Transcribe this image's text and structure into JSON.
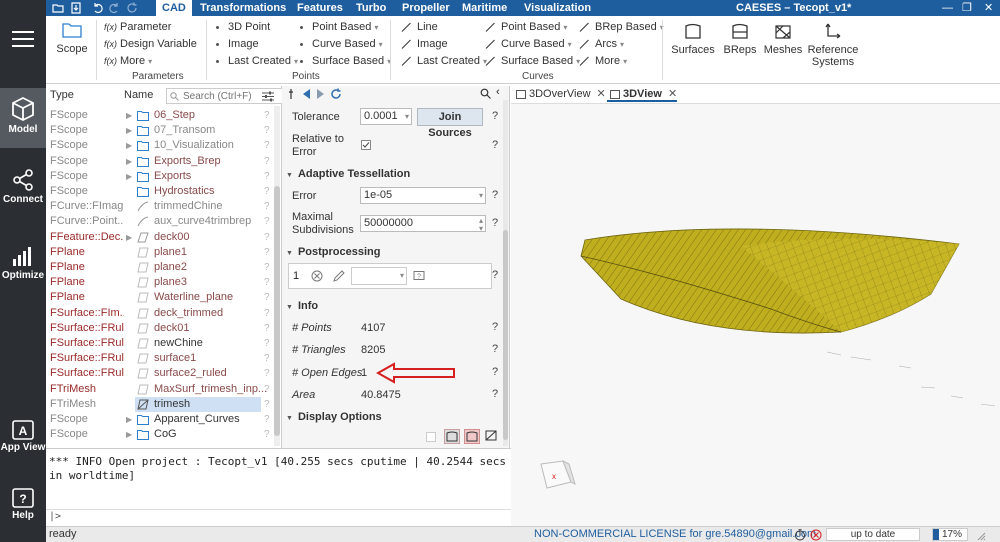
{
  "menubar": {
    "tabs": [
      "CAD",
      "Transformations",
      "Features",
      "Turbo",
      "Propeller",
      "Maritime",
      "Visualization"
    ],
    "active_tab": "CAD",
    "app_title": "CAESES  –  Tecopt_v1*"
  },
  "ribbon": {
    "scope_label": "Scope",
    "parameters": {
      "items": [
        "Parameter",
        "Design Variable",
        "More"
      ],
      "group_label": "Parameters"
    },
    "points": {
      "col1": [
        "3D Point",
        "Image",
        "Last Created"
      ],
      "col2": [
        "Point Based",
        "Curve Based",
        "Surface Based"
      ],
      "group_label": "Points"
    },
    "curves": {
      "col1": [
        "Line",
        "Image",
        "Last Created"
      ],
      "col2": [
        "Point Based",
        "Curve Based",
        "Surface Based"
      ],
      "col3": [
        "BRep Based",
        "Arcs",
        "More"
      ],
      "group_label": "Curves"
    },
    "big_buttons": [
      "Surfaces",
      "BReps",
      "Meshes",
      "Reference Systems"
    ]
  },
  "leftbar": {
    "items": [
      "Model",
      "Connect",
      "Optimize",
      "App View",
      "Help"
    ]
  },
  "tree": {
    "col_type": "Type",
    "col_name": "Name",
    "search_placeholder": "Search (Ctrl+F)",
    "rows": [
      {
        "type": "FScope",
        "name": "06_Step",
        "icon": "folder",
        "arrow": true,
        "type_red": false,
        "name_style": "red"
      },
      {
        "type": "FScope",
        "name": "07_Transom",
        "icon": "folder",
        "arrow": true,
        "type_red": false,
        "name_style": "grey"
      },
      {
        "type": "FScope",
        "name": "10_Visualization",
        "icon": "folder",
        "arrow": true,
        "type_red": false,
        "name_style": "grey"
      },
      {
        "type": "FScope",
        "name": "Exports_Brep",
        "icon": "folder",
        "arrow": true,
        "type_red": false,
        "name_style": "red"
      },
      {
        "type": "FScope",
        "name": "Exports",
        "icon": "folder",
        "arrow": true,
        "type_red": false,
        "name_style": "red"
      },
      {
        "type": "FScope",
        "name": "Hydrostatics",
        "icon": "folder",
        "arrow": false,
        "type_red": false,
        "name_style": "red"
      },
      {
        "type": "FCurve::FImag...",
        "name": "trimmedChine",
        "icon": "curve",
        "arrow": false,
        "type_red": false,
        "name_style": "grey"
      },
      {
        "type": "FCurve::Point...",
        "name": "aux_curve4trimbrep",
        "icon": "curve",
        "arrow": false,
        "type_red": false,
        "name_style": "grey"
      },
      {
        "type": "FFeature::Dec...",
        "name": "deck00",
        "icon": "feature",
        "arrow": true,
        "type_red": true,
        "name_style": "red"
      },
      {
        "type": "FPlane",
        "name": "plane1",
        "icon": "plane",
        "arrow": false,
        "type_red": true,
        "name_style": "red"
      },
      {
        "type": "FPlane",
        "name": "plane2",
        "icon": "plane",
        "arrow": false,
        "type_red": true,
        "name_style": "red"
      },
      {
        "type": "FPlane",
        "name": "plane3",
        "icon": "plane",
        "arrow": false,
        "type_red": true,
        "name_style": "red"
      },
      {
        "type": "FPlane",
        "name": "Waterline_plane",
        "icon": "plane",
        "arrow": false,
        "type_red": true,
        "name_style": "red"
      },
      {
        "type": "FSurface::FIm...",
        "name": "deck_trimmed",
        "icon": "plane",
        "arrow": false,
        "type_red": true,
        "name_style": "red"
      },
      {
        "type": "FSurface::FRul...",
        "name": "deck01",
        "icon": "plane",
        "arrow": false,
        "type_red": true,
        "name_style": "red"
      },
      {
        "type": "FSurface::FRul...",
        "name": "newChine",
        "icon": "plane",
        "arrow": false,
        "type_red": true,
        "name_style": "dark"
      },
      {
        "type": "FSurface::FRul...",
        "name": "surface1",
        "icon": "plane",
        "arrow": false,
        "type_red": true,
        "name_style": "red"
      },
      {
        "type": "FSurface::FRul...",
        "name": "surface2_ruled",
        "icon": "plane",
        "arrow": false,
        "type_red": true,
        "name_style": "red"
      },
      {
        "type": "FTriMesh",
        "name": "MaxSurf_trimesh_inp...",
        "icon": "plane",
        "arrow": false,
        "type_red": true,
        "name_style": "red"
      },
      {
        "type": "FTriMesh",
        "name": "trimesh",
        "icon": "mesh",
        "arrow": false,
        "type_red": false,
        "name_style": "dark",
        "selected": true
      },
      {
        "type": "FScope",
        "name": "Apparent_Curves",
        "icon": "folder",
        "arrow": true,
        "type_red": false,
        "name_style": "dark"
      },
      {
        "type": "FScope",
        "name": "CoG",
        "icon": "folder",
        "arrow": true,
        "type_red": false,
        "name_style": "dark"
      }
    ]
  },
  "props": {
    "tolerance_label": "Tolerance",
    "tolerance_value": "0.0001",
    "join_sources": "Join Sources",
    "relative_label": "Relative to Error",
    "adaptive_section": "Adaptive Tessellation",
    "error_label": "Error",
    "error_value": "1e-05",
    "maxsub_label": "Maximal Subdivisions",
    "maxsub_value": "50000000",
    "post_section": "Postprocessing",
    "post_index": "1",
    "info_section": "Info",
    "points_label": "# Points",
    "points_value": "4107",
    "triangles_label": "# Triangles",
    "triangles_value": "8205",
    "open_edges_label": "# Open Edges",
    "open_edges_value": "1",
    "area_label": "Area",
    "area_value": "40.8475",
    "display_section": "Display Options",
    "q": "?"
  },
  "viewport": {
    "tabs": [
      "3DOverView",
      "3DView"
    ],
    "active_tab": "3DView",
    "hull_color": "#b8a81a",
    "marker_label": "x"
  },
  "console": {
    "text": "*** INFO Open project : Tecopt_v1 [40.255 secs cputime | 40.2544 secs in worldtime]",
    "prompt": "|>"
  },
  "statusbar": {
    "ready": "ready",
    "license": "NON-COMMERCIAL LICENSE for gre.54890@gmail.com",
    "up_to_date": "up to date",
    "progress_percent": 17,
    "progress_text": "17%"
  },
  "colors": {
    "accent": "#1f5e9e",
    "arrow_red": "#d62020"
  }
}
